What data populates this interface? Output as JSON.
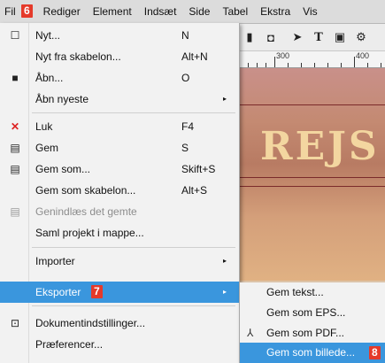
{
  "menubar": {
    "items": [
      "Fil",
      "Rediger",
      "Element",
      "Indsæt",
      "Side",
      "Tabel",
      "Ekstra",
      "Vis"
    ],
    "step_badge": "6"
  },
  "document": {
    "toolbar_icons": [
      "new-icon",
      "cursor-icon",
      "text-tool-icon",
      "image-tool-icon",
      "settings-icon"
    ],
    "ruler_labels": [
      "300",
      "400"
    ],
    "title_text": "REJS"
  },
  "file_menu": {
    "items": [
      {
        "label": "Nyt...",
        "shortcut": "N",
        "icon": "blank-page-icon"
      },
      {
        "label": "Nyt fra skabelon...",
        "shortcut": "Alt+N"
      },
      {
        "label": "Åbn...",
        "shortcut": "O",
        "icon": "folder-icon"
      },
      {
        "label": "Åbn nyeste",
        "submenu": true
      },
      {
        "label": "Luk",
        "shortcut": "F4",
        "icon": "close-icon"
      },
      {
        "label": "Gem",
        "shortcut": "S",
        "icon": "save-icon"
      },
      {
        "label": "Gem som...",
        "shortcut": "Skift+S",
        "icon": "save-as-icon"
      },
      {
        "label": "Gem som skabelon...",
        "shortcut": "Alt+S"
      },
      {
        "label": "Genindlæs det gemte",
        "disabled": true,
        "icon": "revert-icon"
      },
      {
        "label": "Saml projekt i mappe..."
      },
      {
        "label": "Importer",
        "submenu": true
      },
      {
        "label": "Eksporter",
        "submenu": true,
        "active": true,
        "badge": "7"
      },
      {
        "label": "Dokumentindstillinger...",
        "icon": "document-settings-icon"
      },
      {
        "label": "Præferencer..."
      }
    ]
  },
  "export_submenu": {
    "items": [
      {
        "label": "Gem tekst..."
      },
      {
        "label": "Gem som EPS..."
      },
      {
        "label": "Gem som PDF...",
        "icon": "pdf-icon"
      },
      {
        "label": "Gem som billede...",
        "active": true,
        "badge": "8"
      }
    ]
  },
  "colors": {
    "highlight": "#3a96dd",
    "badge": "#e53a2a",
    "menu_bg": "#f2f2f2"
  }
}
